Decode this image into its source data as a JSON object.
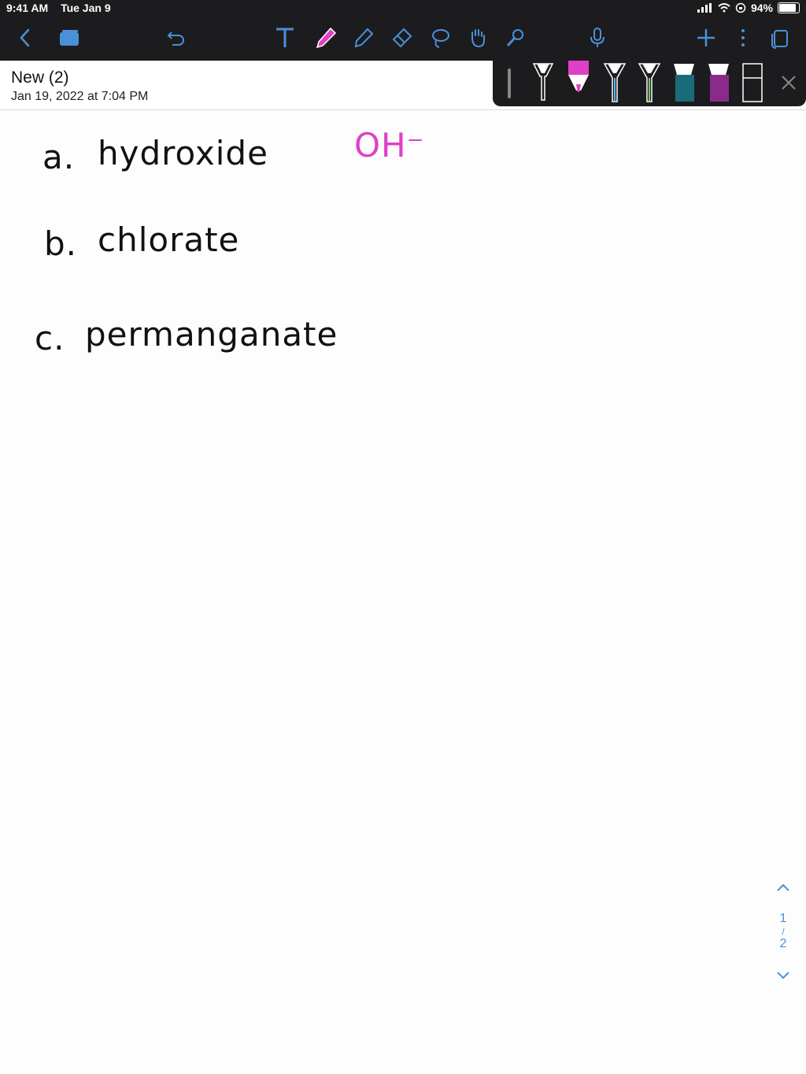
{
  "status": {
    "time": "9:41 AM",
    "date": "Tue Jan 9",
    "battery": "94%",
    "battery_level": 0.94
  },
  "toolbar": {
    "icons": [
      "back-icon",
      "pages-icon",
      "undo-icon",
      "text-tool-icon",
      "pen-tool-icon",
      "highlighter-tool-icon",
      "eraser-tool-icon",
      "lasso-tool-icon",
      "hand-tool-icon",
      "laser-pointer-icon",
      "microphone-icon",
      "add-icon",
      "more-icon",
      "page-layout-icon"
    ],
    "accent": "#4a90d9",
    "pen_active_color": "#e040c8"
  },
  "document": {
    "title": "New (2)",
    "date": "Jan 19, 2022 at 7:04 PM"
  },
  "pen_tray": {
    "colors": [
      "#333333",
      "#ffffff",
      "#e040c8",
      "#5bb8e8",
      "#7ec86a",
      "#1a6b7a",
      "#8a2a8a",
      "#ffffff"
    ]
  },
  "notes": {
    "line_a_label": "a.",
    "line_a_text": "hydroxide",
    "line_a_answer": "OH⁻",
    "line_b_label": "b.",
    "line_b_text": "chlorate",
    "line_c_label": "c.",
    "line_c_text": "permanganate",
    "answer_color": "#e040c8"
  },
  "pager": {
    "current": "1",
    "separator": "/",
    "total": "2"
  }
}
